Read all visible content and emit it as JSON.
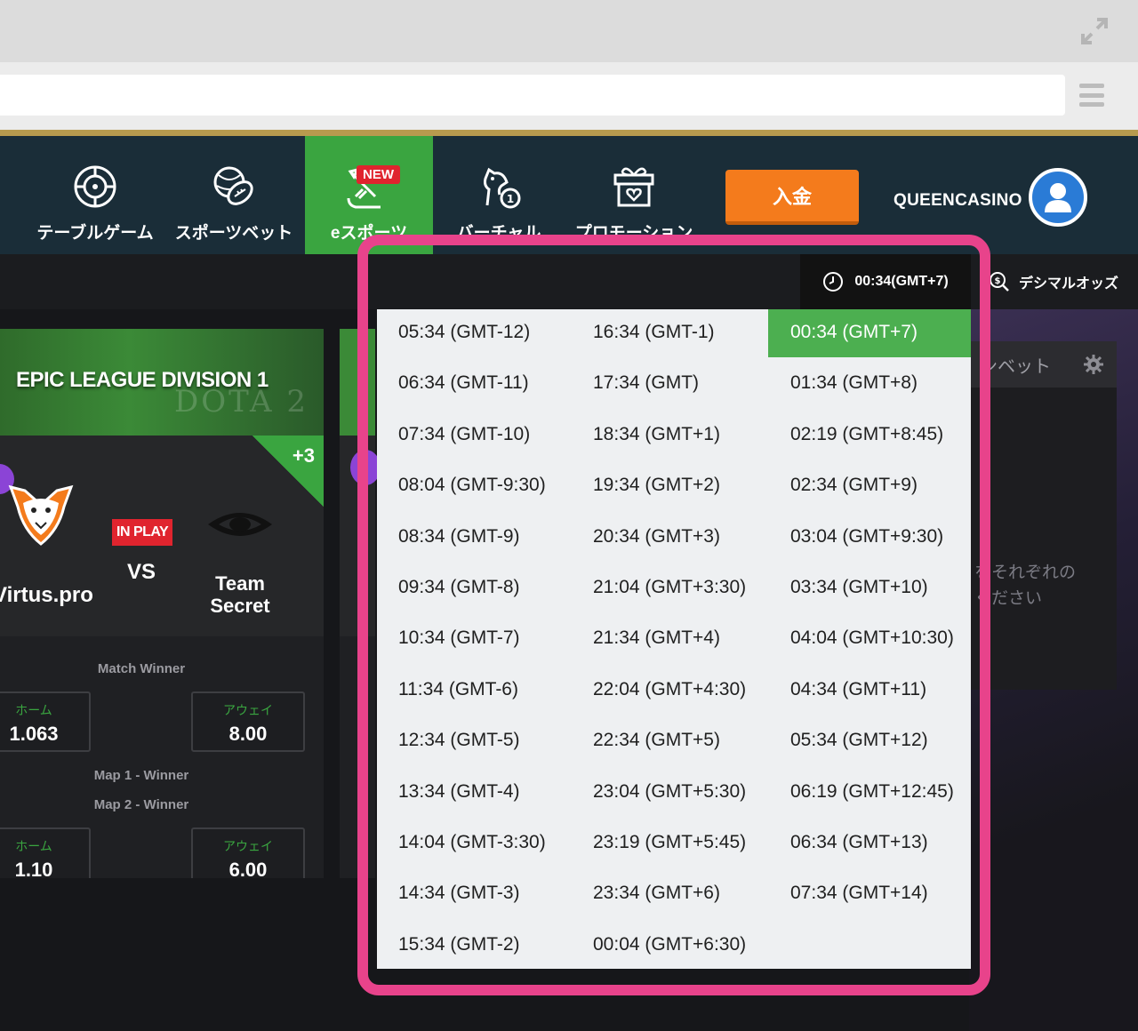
{
  "navbar": {
    "items": [
      {
        "label": "テーブルゲーム",
        "icon": "roulette-icon"
      },
      {
        "label": "スポーツベット",
        "icon": "sports-balls-icon"
      },
      {
        "label": "eスポーツ",
        "icon": "esports-icon",
        "badge": "NEW",
        "active": true
      },
      {
        "label": "バーチャル",
        "icon": "horse-icon"
      },
      {
        "label": "プロモーション",
        "icon": "gift-icon"
      }
    ],
    "deposit_label": "入金",
    "brand": "QUEENCASINO"
  },
  "info_bar": {
    "current_time": "00:34(GMT+7)",
    "odds_format": "デシマルオッズ"
  },
  "match": {
    "league": "EPIC LEAGUE DIVISION 1",
    "more_markets": "+3",
    "home_team": "Virtus.pro",
    "away_team_line1": "Team",
    "away_team_line2": "Secret",
    "status": "IN PLAY",
    "vs": "VS",
    "markets": [
      {
        "name": "Match Winner",
        "home_label": "ホーム",
        "home_odds": "1.063",
        "away_label": "アウェイ",
        "away_odds": "8.00"
      },
      {
        "name": "Map 1 - Winner"
      },
      {
        "name": "Map 2 - Winner",
        "home_label": "ホーム",
        "home_odds": "1.10",
        "away_label": "アウェイ",
        "away_odds": "6.00"
      }
    ]
  },
  "bet_slip": {
    "title": "ンベット",
    "message_line1": "をそれぞれの",
    "message_line2": "ください"
  },
  "timezones": {
    "column1": [
      "05:34 (GMT-12)",
      "06:34 (GMT-11)",
      "07:34 (GMT-10)",
      "08:04 (GMT-9:30)",
      "08:34 (GMT-9)",
      "09:34 (GMT-8)",
      "10:34 (GMT-7)",
      "11:34 (GMT-6)",
      "12:34 (GMT-5)",
      "13:34 (GMT-4)",
      "14:04 (GMT-3:30)",
      "14:34 (GMT-3)",
      "15:34 (GMT-2)"
    ],
    "column2": [
      "16:34 (GMT-1)",
      "17:34 (GMT)",
      "18:34 (GMT+1)",
      "19:34 (GMT+2)",
      "20:34 (GMT+3)",
      "21:04 (GMT+3:30)",
      "21:34 (GMT+4)",
      "22:04 (GMT+4:30)",
      "22:34 (GMT+5)",
      "23:04 (GMT+5:30)",
      "23:19 (GMT+5:45)",
      "23:34 (GMT+6)",
      "00:04 (GMT+6:30)"
    ],
    "column3": [
      "00:34 (GMT+7)",
      "01:34 (GMT+8)",
      "02:19 (GMT+8:45)",
      "02:34 (GMT+9)",
      "03:04 (GMT+9:30)",
      "03:34 (GMT+10)",
      "04:04 (GMT+10:30)",
      "04:34 (GMT+11)",
      "05:34 (GMT+12)",
      "06:19 (GMT+12:45)",
      "06:34 (GMT+13)",
      "07:34 (GMT+14)"
    ],
    "selected": "00:34 (GMT+7)"
  },
  "colors": {
    "accent_green": "#4caf50",
    "highlight_pink": "#e8438b",
    "deposit_orange": "#f47b1c",
    "navbar_bg": "#1a2d38"
  }
}
